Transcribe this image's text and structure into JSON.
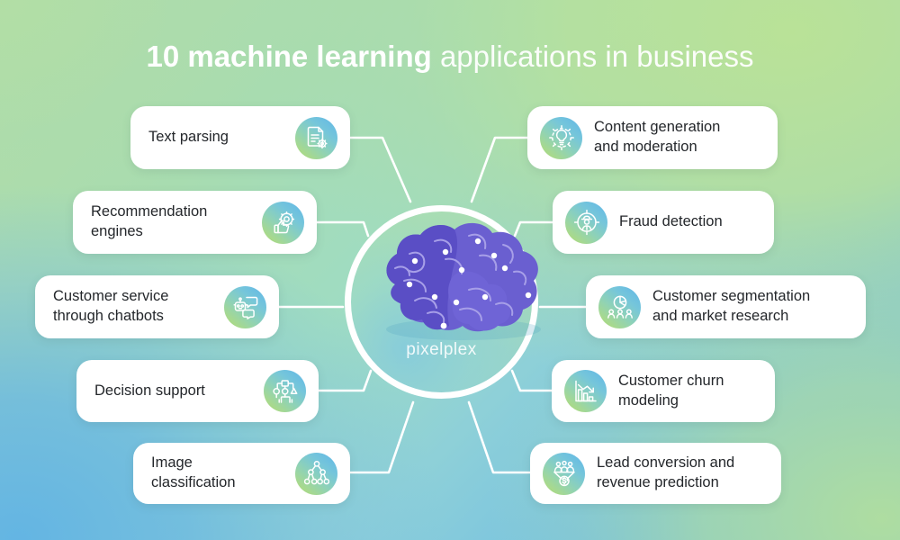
{
  "title": {
    "bold_part": "10 machine learning",
    "light_part": " applications in business"
  },
  "hub": {
    "watermark": "pixelplex",
    "graphic": "brain-illustration"
  },
  "colors": {
    "background_green": "#b2dda6",
    "background_blue": "#66b6e6",
    "card_background": "#ffffff",
    "text": "#24272b",
    "title_text": "#ffffff",
    "icon_gradient_start": "#9fd56a",
    "icon_gradient_end": "#5fb6e8",
    "brain_purple": "#5b4fc4",
    "connector_line": "#ffffff"
  },
  "left_cards": [
    {
      "label": "Text parsing",
      "icon": "document-gear-icon"
    },
    {
      "label": "Recommendation\nengines",
      "icon": "thumbs-up-gear-icon"
    },
    {
      "label": "Customer service\nthrough chatbots",
      "icon": "chatbot-icon"
    },
    {
      "label": "Decision support",
      "icon": "decision-tree-icon"
    },
    {
      "label": "Image\nclassification",
      "icon": "neural-network-icon"
    }
  ],
  "right_cards": [
    {
      "label": "Content generation\nand moderation",
      "icon": "lightbulb-gear-icon"
    },
    {
      "label": "Fraud detection",
      "icon": "detective-target-icon"
    },
    {
      "label": "Customer segmentation\nand market research",
      "icon": "pie-chart-people-icon"
    },
    {
      "label": "Customer churn\nmodeling",
      "icon": "declining-bar-chart-icon"
    },
    {
      "label": "Lead conversion and\nrevenue prediction",
      "icon": "funnel-dollar-people-icon"
    }
  ]
}
